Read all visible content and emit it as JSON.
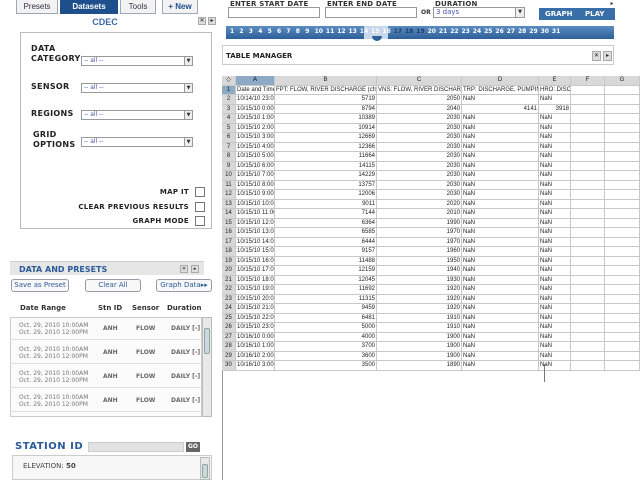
{
  "tabs": [
    {
      "label": "Presets",
      "active": false
    },
    {
      "label": "Datasets",
      "active": true
    },
    {
      "label": "Tools",
      "active": false
    },
    {
      "label": "+ New",
      "active": false
    }
  ],
  "cdec": {
    "title": "CDEC",
    "fields": [
      {
        "label_lines": [
          "DATA",
          "CATEGORY"
        ],
        "value": "-- all --"
      },
      {
        "label_lines": [
          "SENSOR"
        ],
        "value": "-- all --"
      },
      {
        "label_lines": [
          "REGIONS"
        ],
        "value": "-- all --"
      },
      {
        "label_lines": [
          "GRID",
          "OPTIONS"
        ],
        "value": "-- all --"
      }
    ],
    "checks": [
      {
        "label": "MAP IT",
        "checked": false
      },
      {
        "label": "CLEAR PREVIOUS RESULTS",
        "checked": false
      },
      {
        "label": "GRAPH MODE",
        "checked": false
      }
    ]
  },
  "data_presets": {
    "title": "DATA AND PRESETS",
    "buttons": {
      "save": "Save as Preset",
      "clear": "Clear All",
      "graph": "Graph Data"
    },
    "columns": [
      "Date Range",
      "Stn ID",
      "Sensor",
      "Duration"
    ],
    "rows": [
      {
        "d1": "Oct. 29, 2010  10:00AM",
        "d2": "Oct. 29, 2010  12:00PM",
        "stn": "ANH",
        "sensor": "FLOW",
        "duration": "DAILY [-]"
      },
      {
        "d1": "Oct. 29, 2010  10:00AM",
        "d2": "Oct. 29, 2010  12:00PM",
        "stn": "ANH",
        "sensor": "FLOW",
        "duration": "DAILY [-]"
      },
      {
        "d1": "Oct. 29, 2010  10:00AM",
        "d2": "Oct. 29, 2010  12:00PM",
        "stn": "ANH",
        "sensor": "FLOW",
        "duration": "DAILY [-]"
      },
      {
        "d1": "Oct. 29, 2010  10:00AM",
        "d2": "Oct. 29, 2010  12:00PM",
        "stn": "ANH",
        "sensor": "FLOW",
        "duration": "DAILY [-]"
      }
    ]
  },
  "station": {
    "title": "STATION ID",
    "go": "GO",
    "elevation_label": "ELEVATION:",
    "elevation_value": "50"
  },
  "controls": {
    "start_label": "ENTER START DATE",
    "end_label": "ENTER END DATE",
    "or": "OR",
    "duration_label": "DURATION",
    "duration_value": "3 days",
    "graph": "GRAPH",
    "play": "PLAY"
  },
  "days": [
    "1",
    "2",
    "3",
    "4",
    "5",
    "6",
    "7",
    "8",
    "9",
    "10",
    "11",
    "12",
    "13",
    "14",
    "15",
    "16",
    "17",
    "18",
    "19",
    "20",
    "21",
    "22",
    "23",
    "24",
    "25",
    "26",
    "27",
    "28",
    "29",
    "30",
    "31"
  ],
  "days_highlighted": [
    "17",
    "18",
    "19"
  ],
  "table_manager": {
    "title": "TABLE MANAGER"
  },
  "sheet": {
    "corner": "◇",
    "columns": [
      "A",
      "B",
      "C",
      "D",
      "E",
      "F",
      "G"
    ],
    "header_row": [
      "Date and Time",
      "FPT: FLOW, RIVER DISCHARGE (cfs)",
      "VNS: FLOW, RIVER DISCHARGE (cfs)",
      "TRP: DISCHARGE, PUMPING (cfs)",
      "HRO: DISCHARGE, PUMPING (cfs)",
      "",
      ""
    ],
    "rows": [
      [
        "10/14/10 23:00",
        "5719",
        "2050",
        "NaN",
        "NaN",
        "",
        ""
      ],
      [
        "10/15/10 0:00",
        "8794",
        "2040",
        "4141",
        "3918",
        "",
        ""
      ],
      [
        "10/15/10 1:00",
        "10389",
        "2030",
        "NaN",
        "NaN",
        "",
        ""
      ],
      [
        "10/15/10 2:00",
        "10914",
        "2030",
        "NaN",
        "NaN",
        "",
        ""
      ],
      [
        "10/15/10 3:00",
        "12669",
        "2030",
        "NaN",
        "NaN",
        "",
        ""
      ],
      [
        "10/15/10 4:00",
        "12366",
        "2030",
        "NaN",
        "NaN",
        "",
        ""
      ],
      [
        "10/15/10 5:00",
        "11664",
        "2030",
        "NaN",
        "NaN",
        "",
        ""
      ],
      [
        "10/15/10 6:00",
        "14115",
        "2030",
        "NaN",
        "NaN",
        "",
        ""
      ],
      [
        "10/15/10 7:00",
        "14229",
        "2030",
        "NaN",
        "NaN",
        "",
        ""
      ],
      [
        "10/15/10 8:00",
        "13757",
        "2030",
        "NaN",
        "NaN",
        "",
        ""
      ],
      [
        "10/15/10 9:00",
        "12006",
        "2030",
        "NaN",
        "NaN",
        "",
        ""
      ],
      [
        "10/15/10 10:00",
        "9011",
        "2020",
        "NaN",
        "NaN",
        "",
        ""
      ],
      [
        "10/15/10 11:00",
        "7144",
        "2010",
        "NaN",
        "NaN",
        "",
        ""
      ],
      [
        "10/15/10 12:00",
        "6364",
        "1990",
        "NaN",
        "NaN",
        "",
        ""
      ],
      [
        "10/15/10 13:00",
        "6585",
        "1970",
        "NaN",
        "NaN",
        "",
        ""
      ],
      [
        "10/15/10 14:00",
        "6444",
        "1970",
        "NaN",
        "NaN",
        "",
        ""
      ],
      [
        "10/15/10 15:00",
        "9157",
        "1960",
        "NaN",
        "NaN",
        "",
        ""
      ],
      [
        "10/15/10 16:00",
        "11488",
        "1950",
        "NaN",
        "NaN",
        "",
        ""
      ],
      [
        "10/15/10 17:00",
        "12159",
        "1940",
        "NaN",
        "NaN",
        "",
        ""
      ],
      [
        "10/15/10 18:00",
        "12045",
        "1930",
        "NaN",
        "NaN",
        "",
        ""
      ],
      [
        "10/15/10 19:00",
        "11692",
        "1920",
        "NaN",
        "NaN",
        "",
        ""
      ],
      [
        "10/15/10 20:00",
        "11315",
        "1920",
        "NaN",
        "NaN",
        "",
        ""
      ],
      [
        "10/15/10 21:00",
        "9459",
        "1920",
        "NaN",
        "NaN",
        "",
        ""
      ],
      [
        "10/15/10 22:00",
        "6481",
        "1910",
        "NaN",
        "NaN",
        "",
        ""
      ],
      [
        "10/15/10 23:00",
        "5000",
        "1910",
        "NaN",
        "NaN",
        "",
        ""
      ],
      [
        "10/16/10 0:00",
        "4000",
        "1900",
        "NaN",
        "NaN",
        "",
        ""
      ],
      [
        "10/16/10 1:00",
        "3700",
        "1900",
        "NaN",
        "NaN",
        "",
        ""
      ],
      [
        "10/16/10 2:00",
        "3600",
        "1900",
        "NaN",
        "NaN",
        "",
        ""
      ],
      [
        "10/16/10 3:00",
        "3500",
        "1890",
        "NaN",
        "NaN",
        "",
        ""
      ]
    ]
  }
}
